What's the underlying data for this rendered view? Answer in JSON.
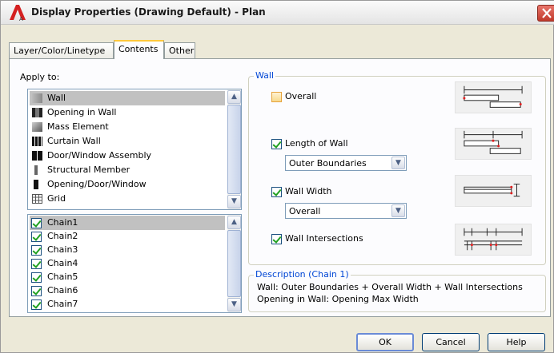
{
  "window": {
    "title": "Display Properties (Drawing Default) - Plan",
    "app_icon": "autocad-architecture-icon",
    "close_icon": "close-icon"
  },
  "tabs": [
    {
      "label": "Layer/Color/Linetype",
      "active": false
    },
    {
      "label": "Contents",
      "active": true
    },
    {
      "label": "Other",
      "active": false
    }
  ],
  "apply_to": {
    "label": "Apply to:",
    "objects": [
      {
        "label": "Wall",
        "icon": "wall-icon",
        "selected": true
      },
      {
        "label": "Opening in Wall",
        "icon": "opening-in-wall-icon",
        "selected": false
      },
      {
        "label": "Mass Element",
        "icon": "mass-element-icon",
        "selected": false
      },
      {
        "label": "Curtain Wall",
        "icon": "curtain-wall-icon",
        "selected": false
      },
      {
        "label": "Door/Window Assembly",
        "icon": "door-window-assembly-icon",
        "selected": false
      },
      {
        "label": "Structural Member",
        "icon": "structural-member-icon",
        "selected": false
      },
      {
        "label": "Opening/Door/Window",
        "icon": "opening-door-window-icon",
        "selected": false
      },
      {
        "label": "Grid",
        "icon": "grid-icon",
        "selected": false
      }
    ],
    "chains": [
      {
        "label": "Chain1",
        "checked": true,
        "selected": true
      },
      {
        "label": "Chain2",
        "checked": true,
        "selected": false
      },
      {
        "label": "Chain3",
        "checked": true,
        "selected": false
      },
      {
        "label": "Chain4",
        "checked": true,
        "selected": false
      },
      {
        "label": "Chain5",
        "checked": true,
        "selected": false
      },
      {
        "label": "Chain6",
        "checked": true,
        "selected": false
      },
      {
        "label": "Chain7",
        "checked": true,
        "selected": false
      }
    ]
  },
  "wall": {
    "group_title": "Wall",
    "overall": {
      "label": "Overall",
      "checked": false
    },
    "length_of_wall": {
      "label": "Length of Wall",
      "checked": true,
      "option": "Outer Boundaries"
    },
    "wall_width": {
      "label": "Wall Width",
      "checked": true,
      "option": "Overall"
    },
    "wall_intersections": {
      "label": "Wall Intersections",
      "checked": true
    }
  },
  "description": {
    "group_title": "Description (Chain 1)",
    "line1": "Wall: Outer Boundaries + Overall Width + Wall Intersections",
    "line2": "Opening in Wall: Opening Max Width"
  },
  "buttons": {
    "ok": "OK",
    "cancel": "Cancel",
    "help": "Help"
  },
  "colors": {
    "group_title": "#0046d5",
    "check": "#21a121",
    "tab_accent": "#ffc83c",
    "dimension_marker": "#e02020"
  }
}
